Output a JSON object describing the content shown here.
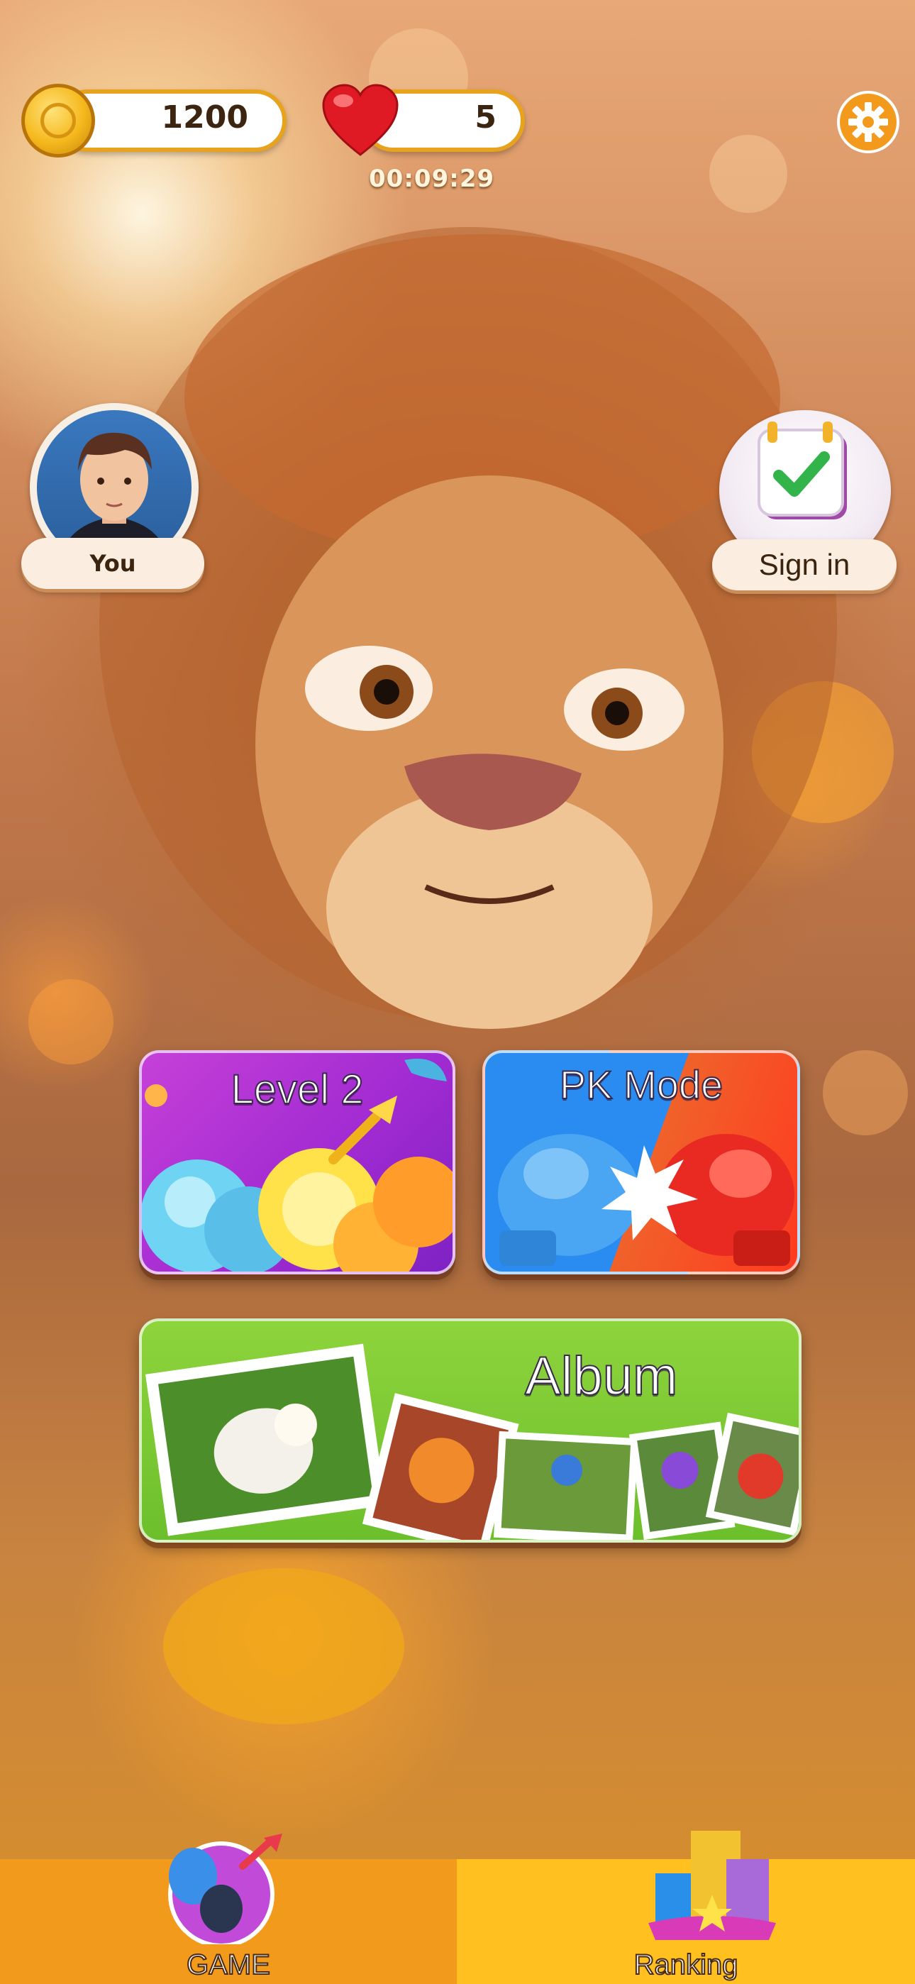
{
  "top_bar": {
    "coins": "1200",
    "lives": "5",
    "life_timer": "00:09:29"
  },
  "profile": {
    "label": "You"
  },
  "daily": {
    "label": "Sign in"
  },
  "modes": {
    "level": {
      "label": "Level 2"
    },
    "pk": {
      "label": "PK Mode"
    },
    "album": {
      "label": "Album"
    }
  },
  "bottom_nav": {
    "tabs": [
      {
        "label": "GAME",
        "icon": "balloon-dart-icon",
        "active": true
      },
      {
        "label": "Ranking",
        "icon": "trophy-blocks-icon",
        "active": false
      }
    ]
  },
  "colors": {
    "accent": "#f39a1c",
    "nav_active": "#f29a1c",
    "nav_inactive": "#ffc020"
  }
}
